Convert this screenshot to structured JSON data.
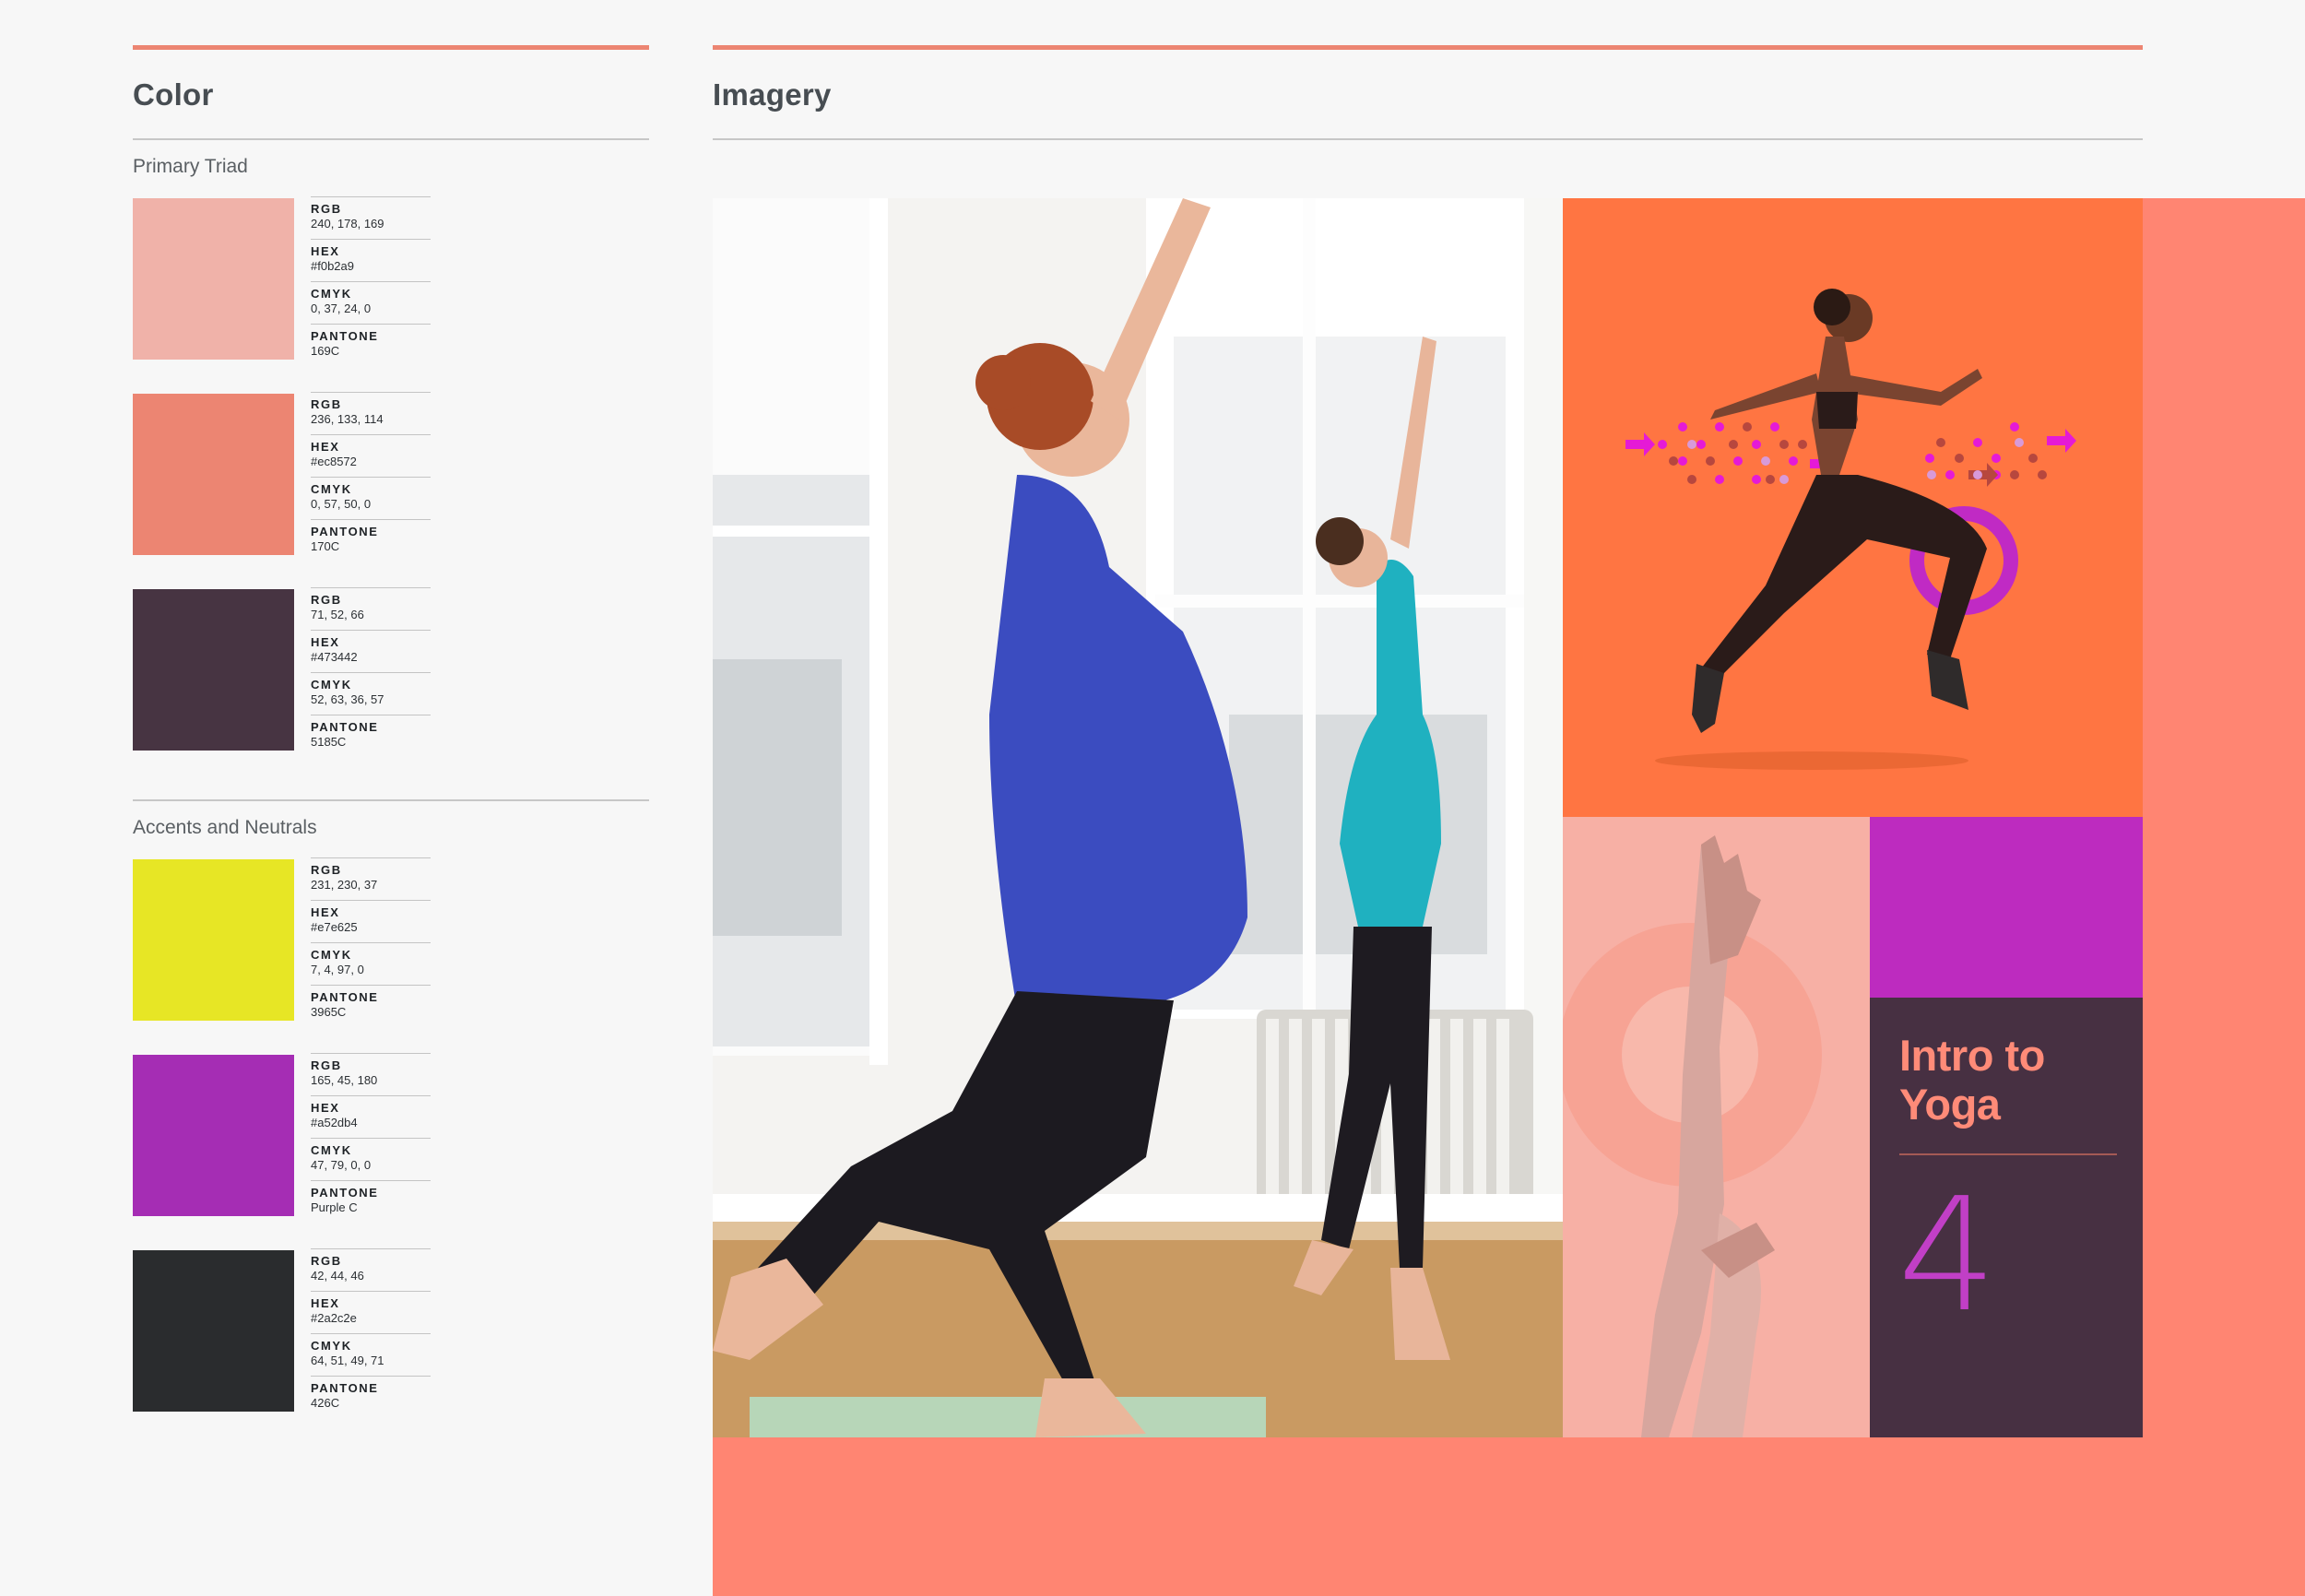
{
  "color": {
    "title": "Color",
    "groups": [
      {
        "title": "Primary Triad",
        "swatches": [
          {
            "color": "#f0b2a9",
            "rgb": "240, 178, 169",
            "hex": "#f0b2a9",
            "cmyk": "0, 37, 24, 0",
            "pantone": "169C"
          },
          {
            "color": "#ec8572",
            "rgb": "236, 133, 114",
            "hex": "#ec8572",
            "cmyk": "0, 57, 50, 0",
            "pantone": "170C"
          },
          {
            "color": "#473442",
            "rgb": "71, 52, 66",
            "hex": "#473442",
            "cmyk": "52, 63, 36, 57",
            "pantone": "5185C"
          }
        ]
      },
      {
        "title": "Accents and Neutrals",
        "swatches": [
          {
            "color": "#e7e625",
            "rgb": "231, 230, 37",
            "hex": "#e7e625",
            "cmyk": "7, 4, 97, 0",
            "pantone": "3965C"
          },
          {
            "color": "#a52db4",
            "rgb": "165, 45, 180",
            "hex": "#a52db4",
            "cmyk": "47, 79, 0, 0",
            "pantone": "Purple C"
          },
          {
            "color": "#2a2c2e",
            "rgb": "42, 44, 46",
            "hex": "#2a2c2e",
            "cmyk": "64, 51, 49, 71",
            "pantone": "426C"
          }
        ]
      }
    ],
    "labels": {
      "rgb": "RGB",
      "hex": "HEX",
      "cmyk": "CMYK",
      "pantone": "PANTONE"
    }
  },
  "imagery": {
    "title": "Imagery",
    "poster": {
      "title": "Intro to Yoga",
      "number": "4"
    }
  },
  "palette": {
    "accent": "#ec8572",
    "orange": "#ff7542",
    "magenta": "#bd2bbf",
    "plum": "#473042",
    "pink": "#f7b0a5"
  }
}
